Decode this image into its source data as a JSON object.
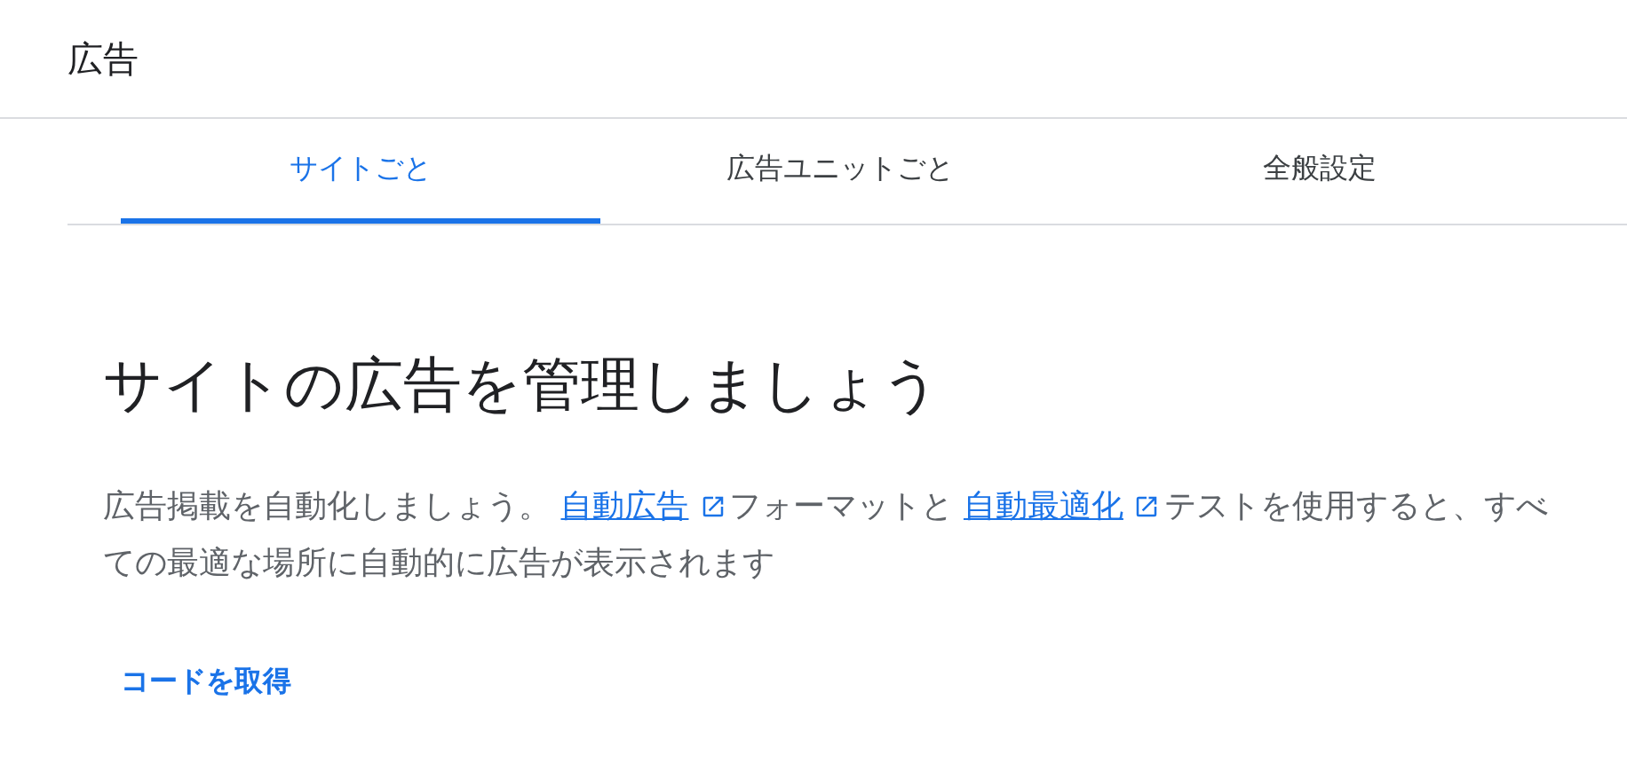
{
  "header": {
    "title": "広告"
  },
  "tabs": [
    {
      "label": "サイトごと",
      "selected": true
    },
    {
      "label": "広告ユニットごと",
      "selected": false
    },
    {
      "label": "全般設定",
      "selected": false
    }
  ],
  "content": {
    "heading": "サイトの広告を管理しましょう",
    "paragraph": [
      {
        "kind": "text",
        "text": "広告掲載を自動化しましょう。 "
      },
      {
        "kind": "link",
        "text": "自動広告"
      },
      {
        "kind": "text",
        "text": "フォーマットと "
      },
      {
        "kind": "link",
        "text": "自動最適化"
      },
      {
        "kind": "text",
        "text": "テストを使用すると、すべての最適な場所に自動的に広告が表示されます"
      }
    ],
    "button": "コードを取得"
  }
}
